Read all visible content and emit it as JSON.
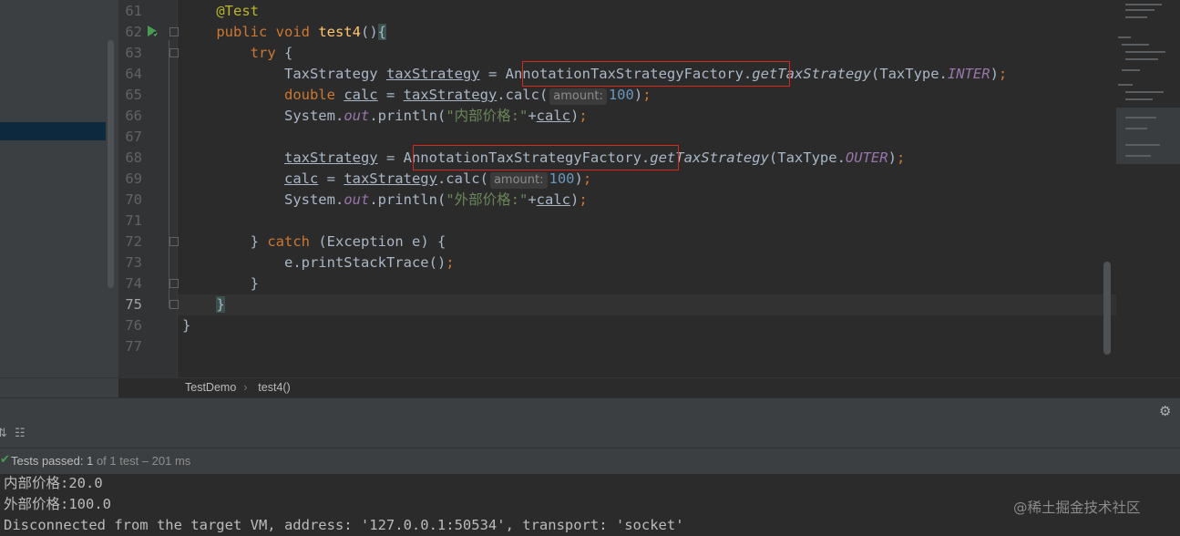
{
  "editor": {
    "lines": [
      {
        "number": "61",
        "segments": [
          {
            "t": "    "
          },
          {
            "t": "@Test",
            "c": "ann"
          }
        ]
      },
      {
        "number": "62",
        "segments": [
          {
            "t": "    "
          },
          {
            "t": "public void ",
            "c": "kw"
          },
          {
            "t": "test4",
            "c": "fn"
          },
          {
            "t": "()"
          },
          {
            "t": "{",
            "c": "brace"
          }
        ]
      },
      {
        "number": "63",
        "segments": [
          {
            "t": "        "
          },
          {
            "t": "try",
            "c": "kw"
          },
          {
            "t": " {"
          }
        ]
      },
      {
        "number": "64",
        "segments": [
          {
            "t": "            TaxStrategy "
          },
          {
            "t": "taxStrategy",
            "c": "ul"
          },
          {
            "t": " = AnnotationTaxStrategyFactory."
          },
          {
            "t": "getTaxStrategy",
            "c": "it"
          },
          {
            "t": "(TaxType."
          },
          {
            "t": "INTER",
            "c": "stat"
          },
          {
            "t": ")"
          },
          {
            "t": ";",
            "c": "kw"
          }
        ]
      },
      {
        "number": "65",
        "segments": [
          {
            "t": "            "
          },
          {
            "t": "double ",
            "c": "kw"
          },
          {
            "t": "calc",
            "c": "ul"
          },
          {
            "t": " = "
          },
          {
            "t": "taxStrategy",
            "c": "ul"
          },
          {
            "t": ".calc("
          },
          {
            "t": "amount:",
            "c": "hint"
          },
          {
            "t": "100",
            "c": "num"
          },
          {
            "t": ")"
          },
          {
            "t": ";",
            "c": "kw"
          }
        ]
      },
      {
        "number": "66",
        "segments": [
          {
            "t": "            System."
          },
          {
            "t": "out",
            "c": "stat"
          },
          {
            "t": ".println("
          },
          {
            "t": "\"内部价格:\"",
            "c": "str"
          },
          {
            "t": "+"
          },
          {
            "t": "calc",
            "c": "ul"
          },
          {
            "t": ")"
          },
          {
            "t": ";",
            "c": "kw"
          }
        ]
      },
      {
        "number": "67",
        "segments": []
      },
      {
        "number": "68",
        "segments": [
          {
            "t": "            "
          },
          {
            "t": "taxStrategy",
            "c": "ul"
          },
          {
            "t": " = AnnotationTaxStrategyFactory."
          },
          {
            "t": "getTaxStrategy",
            "c": "it"
          },
          {
            "t": "(TaxType."
          },
          {
            "t": "OUTER",
            "c": "stat"
          },
          {
            "t": ")"
          },
          {
            "t": ";",
            "c": "kw"
          }
        ]
      },
      {
        "number": "69",
        "segments": [
          {
            "t": "            "
          },
          {
            "t": "calc",
            "c": "ul"
          },
          {
            "t": " = "
          },
          {
            "t": "taxStrategy",
            "c": "ul"
          },
          {
            "t": ".calc("
          },
          {
            "t": "amount:",
            "c": "hint"
          },
          {
            "t": "100",
            "c": "num"
          },
          {
            "t": ")"
          },
          {
            "t": ";",
            "c": "kw"
          }
        ]
      },
      {
        "number": "70",
        "segments": [
          {
            "t": "            System."
          },
          {
            "t": "out",
            "c": "stat"
          },
          {
            "t": ".println("
          },
          {
            "t": "\"外部价格:\"",
            "c": "str"
          },
          {
            "t": "+"
          },
          {
            "t": "calc",
            "c": "ul"
          },
          {
            "t": ")"
          },
          {
            "t": ";",
            "c": "kw"
          }
        ]
      },
      {
        "number": "71",
        "segments": []
      },
      {
        "number": "72",
        "segments": [
          {
            "t": "        } "
          },
          {
            "t": "catch",
            "c": "kw"
          },
          {
            "t": " (Exception e) {"
          }
        ]
      },
      {
        "number": "73",
        "segments": [
          {
            "t": "            e.printStackTrace()"
          },
          {
            "t": ";",
            "c": "kw"
          }
        ]
      },
      {
        "number": "74",
        "segments": [
          {
            "t": "        }"
          }
        ]
      },
      {
        "number": "75",
        "segments": [
          {
            "t": "    "
          },
          {
            "t": "}",
            "c": "brace"
          }
        ]
      },
      {
        "number": "76",
        "segments": [
          {
            "t": "}"
          }
        ]
      },
      {
        "number": "77",
        "segments": []
      }
    ],
    "current_line": "75"
  },
  "breadcrumb": {
    "class_name": "TestDemo",
    "separator": "›",
    "method_name": "test4()"
  },
  "run_panel": {
    "settings_icon": "gear-icon",
    "status_prefix": "Tests passed: ",
    "passed_count": "1",
    "status_suffix": " of 1 test – 201 ms",
    "console_lines": [
      "内部价格:20.0",
      "外部价格:100.0",
      "Disconnected from the target VM, address: '127.0.0.1:50534', transport: 'socket'"
    ]
  },
  "watermark": "@稀土掘金技术社区",
  "colors": {
    "background": "#2b2b2b",
    "keyword": "#cc7832",
    "annotation": "#bbb529",
    "method": "#ffc66d",
    "number": "#6897bb",
    "string": "#6a8759",
    "static": "#9876aa",
    "highlight_box": "#d9291c"
  }
}
